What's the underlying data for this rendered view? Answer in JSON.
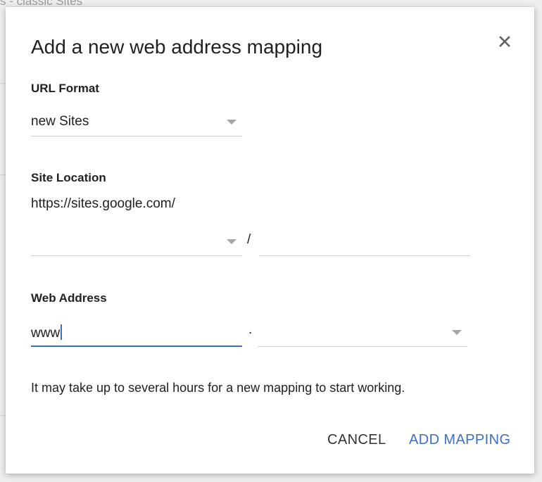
{
  "background": {
    "heading": "s - classic Sites"
  },
  "dialog": {
    "title": "Add a new web address mapping",
    "close_icon": "close-icon",
    "url_format": {
      "label": "URL Format",
      "value": "new Sites"
    },
    "site_location": {
      "label": "Site Location",
      "base_url": "https://sites.google.com/",
      "domain_value": "",
      "separator": "/",
      "path_value": ""
    },
    "web_address": {
      "label": "Web Address",
      "subdomain_value": "www",
      "separator": ".",
      "domain_value": ""
    },
    "note": "It may take up to several hours for a new mapping to start working.",
    "buttons": {
      "cancel": "CANCEL",
      "add_mapping": "ADD MAPPING"
    }
  },
  "colors": {
    "accent": "#3f6fc2",
    "text": "#212121",
    "underline": "#cfcfcf",
    "caret": "#a6a6a6",
    "overlay": "#e4e4e4"
  }
}
